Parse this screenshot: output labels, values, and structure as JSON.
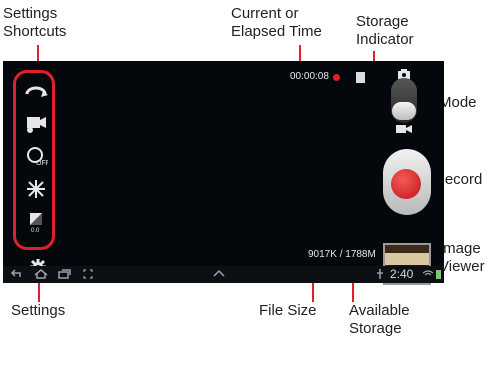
{
  "callouts": {
    "settings_shortcuts": [
      "Settings",
      "Shortcuts"
    ],
    "current_time": [
      "Current or",
      "Elapsed Time"
    ],
    "storage_indicator": [
      "Storage",
      "Indicator"
    ],
    "mode": "Mode",
    "record": "Record",
    "image_viewer": [
      "Image",
      "Viewer"
    ],
    "settings": "Settings",
    "file_size": "File Size",
    "available_storage": [
      "Available",
      "Storage"
    ]
  },
  "camera": {
    "elapsed_time": "00:00:08",
    "file_size_readout": "9017K / 1788M",
    "clock": "2:40"
  },
  "colors": {
    "accent": "#e0202a",
    "screen_bg": "#04070b"
  }
}
